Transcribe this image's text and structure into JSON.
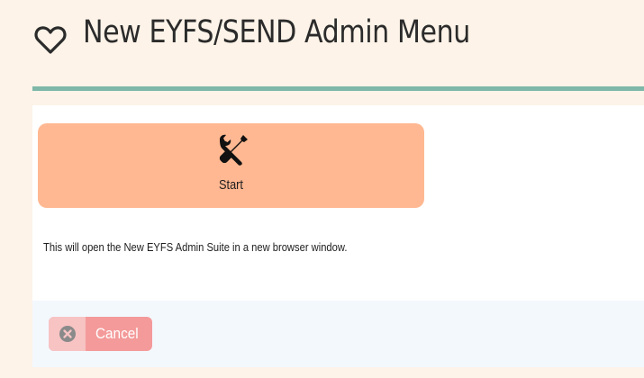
{
  "header": {
    "title": "New EYFS/SEND Admin Menu",
    "icon": "heart-outline-icon"
  },
  "tiles": [
    {
      "label": "Start",
      "icon": "tools-icon",
      "color": "#ffb891"
    }
  ],
  "description": "This will open the New EYFS Admin Suite in a new browser window.",
  "footer": {
    "cancel_label": "Cancel",
    "cancel_icon": "close-circle-icon",
    "cancel_color": "#f49a9a"
  },
  "colors": {
    "background": "#fdf3e8",
    "accent_rule": "#7fb7a8",
    "footer_background": "#f3f8fd"
  }
}
